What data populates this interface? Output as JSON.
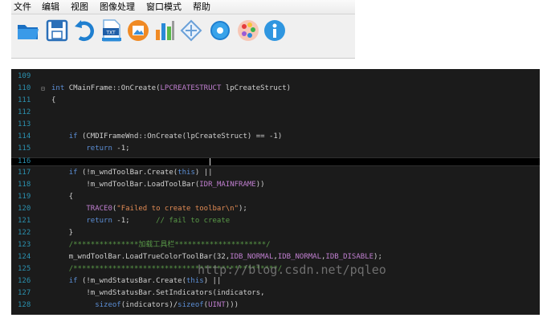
{
  "menu": {
    "file": "文件",
    "edit": "编辑",
    "view": "视图",
    "image": "图像处理",
    "window_mode": "窗口模式",
    "help": "帮助"
  },
  "toolbar": {
    "icons": [
      "open-folder-icon",
      "save-icon",
      "undo-icon",
      "txt-file-icon",
      "image-icon",
      "bar-chart-icon",
      "move-icon",
      "circle-icon",
      "palette-icon",
      "info-icon"
    ],
    "colors": {
      "blue": "#1f7fd0",
      "orange": "#f08a24",
      "gray": "#9b9b9b"
    }
  },
  "editor": {
    "lines": [
      {
        "no": "109",
        "fold": "",
        "code": ""
      },
      {
        "no": "110",
        "fold": "⊟",
        "code": "int CMainFrame::OnCreate(LPCREATESTRUCT lpCreateStruct)"
      },
      {
        "no": "111",
        "fold": "",
        "code": "{"
      },
      {
        "no": "112",
        "fold": "",
        "code": ""
      },
      {
        "no": "113",
        "fold": "",
        "code": ""
      },
      {
        "no": "114",
        "fold": "",
        "code": "    if (CMDIFrameWnd::OnCreate(lpCreateStruct) == -1)"
      },
      {
        "no": "115",
        "fold": "",
        "code": "        return -1;"
      },
      {
        "no": "116",
        "fold": "",
        "code": ""
      },
      {
        "no": "117",
        "fold": "",
        "code": "    if (!m_wndToolBar.Create(this) ||"
      },
      {
        "no": "118",
        "fold": "",
        "code": "        !m_wndToolBar.LoadToolBar(IDR_MAINFRAME))"
      },
      {
        "no": "119",
        "fold": "",
        "code": "    {"
      },
      {
        "no": "120",
        "fold": "",
        "code": "        TRACE0(\"Failed to create toolbar\\n\");"
      },
      {
        "no": "121",
        "fold": "",
        "code": "        return -1;      // fail to create"
      },
      {
        "no": "122",
        "fold": "",
        "code": "    }"
      },
      {
        "no": "123",
        "fold": "",
        "code": "    /***************加载工具栏*********************/"
      },
      {
        "no": "124",
        "fold": "",
        "code": "    m_wndToolBar.LoadTrueColorToolBar(32,IDB_NORMAL,IDB_NORMAL,IDB_DISABLE);"
      },
      {
        "no": "125",
        "fold": "",
        "code": "    /***********************************************/"
      },
      {
        "no": "126",
        "fold": "",
        "code": "    if (!m_wndStatusBar.Create(this) ||"
      },
      {
        "no": "127",
        "fold": "",
        "code": "        !m_wndStatusBar.SetIndicators(indicators,"
      },
      {
        "no": "128",
        "fold": "",
        "code": "          sizeof(indicators)/sizeof(UINT)))"
      }
    ],
    "watermark": "http://blog.csdn.net/pqleo"
  }
}
